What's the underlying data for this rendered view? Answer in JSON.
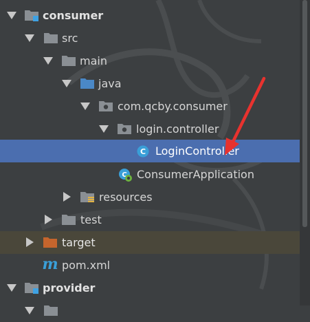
{
  "project_tree": {
    "items": [
      {
        "label": "consumer",
        "kind": "module",
        "expanded": true
      },
      {
        "label": "src",
        "kind": "folder",
        "expanded": true
      },
      {
        "label": "main",
        "kind": "folder",
        "expanded": true
      },
      {
        "label": "java",
        "kind": "source-root",
        "expanded": true
      },
      {
        "label": "com.qcby.consumer",
        "kind": "package",
        "expanded": true
      },
      {
        "label": "login.controller",
        "kind": "package",
        "expanded": true
      },
      {
        "label": "LoginController",
        "kind": "class",
        "selected": true
      },
      {
        "label": "ConsumerApplication",
        "kind": "spring-boot-class"
      },
      {
        "label": "resources",
        "kind": "resources-folder",
        "expanded": false
      },
      {
        "label": "test",
        "kind": "folder",
        "expanded": false
      },
      {
        "label": "target",
        "kind": "excluded-folder",
        "expanded": false
      },
      {
        "label": "pom.xml",
        "kind": "maven-file"
      },
      {
        "label": "provider",
        "kind": "module",
        "expanded": true
      }
    ],
    "class_icon_letter": "C",
    "maven_icon_letter": "m"
  },
  "colors": {
    "background": "#3c3f41",
    "selection": "#4b6eaf",
    "excluded_row": "#4a473a",
    "annotation_arrow": "#e8322e",
    "folder": "#8a8f94",
    "source_root": "#4a88c7",
    "excluded_folder": "#c5652d"
  },
  "icons": {
    "expanded": "chevron-down-icon",
    "collapsed": "chevron-right-icon",
    "module": "module-folder-icon",
    "folder": "folder-icon",
    "source_root": "source-root-folder-icon",
    "package": "package-icon",
    "class": "java-class-icon",
    "spring_boot": "spring-boot-class-icon",
    "resources": "resources-folder-icon",
    "excluded": "excluded-folder-icon",
    "maven": "maven-icon"
  }
}
